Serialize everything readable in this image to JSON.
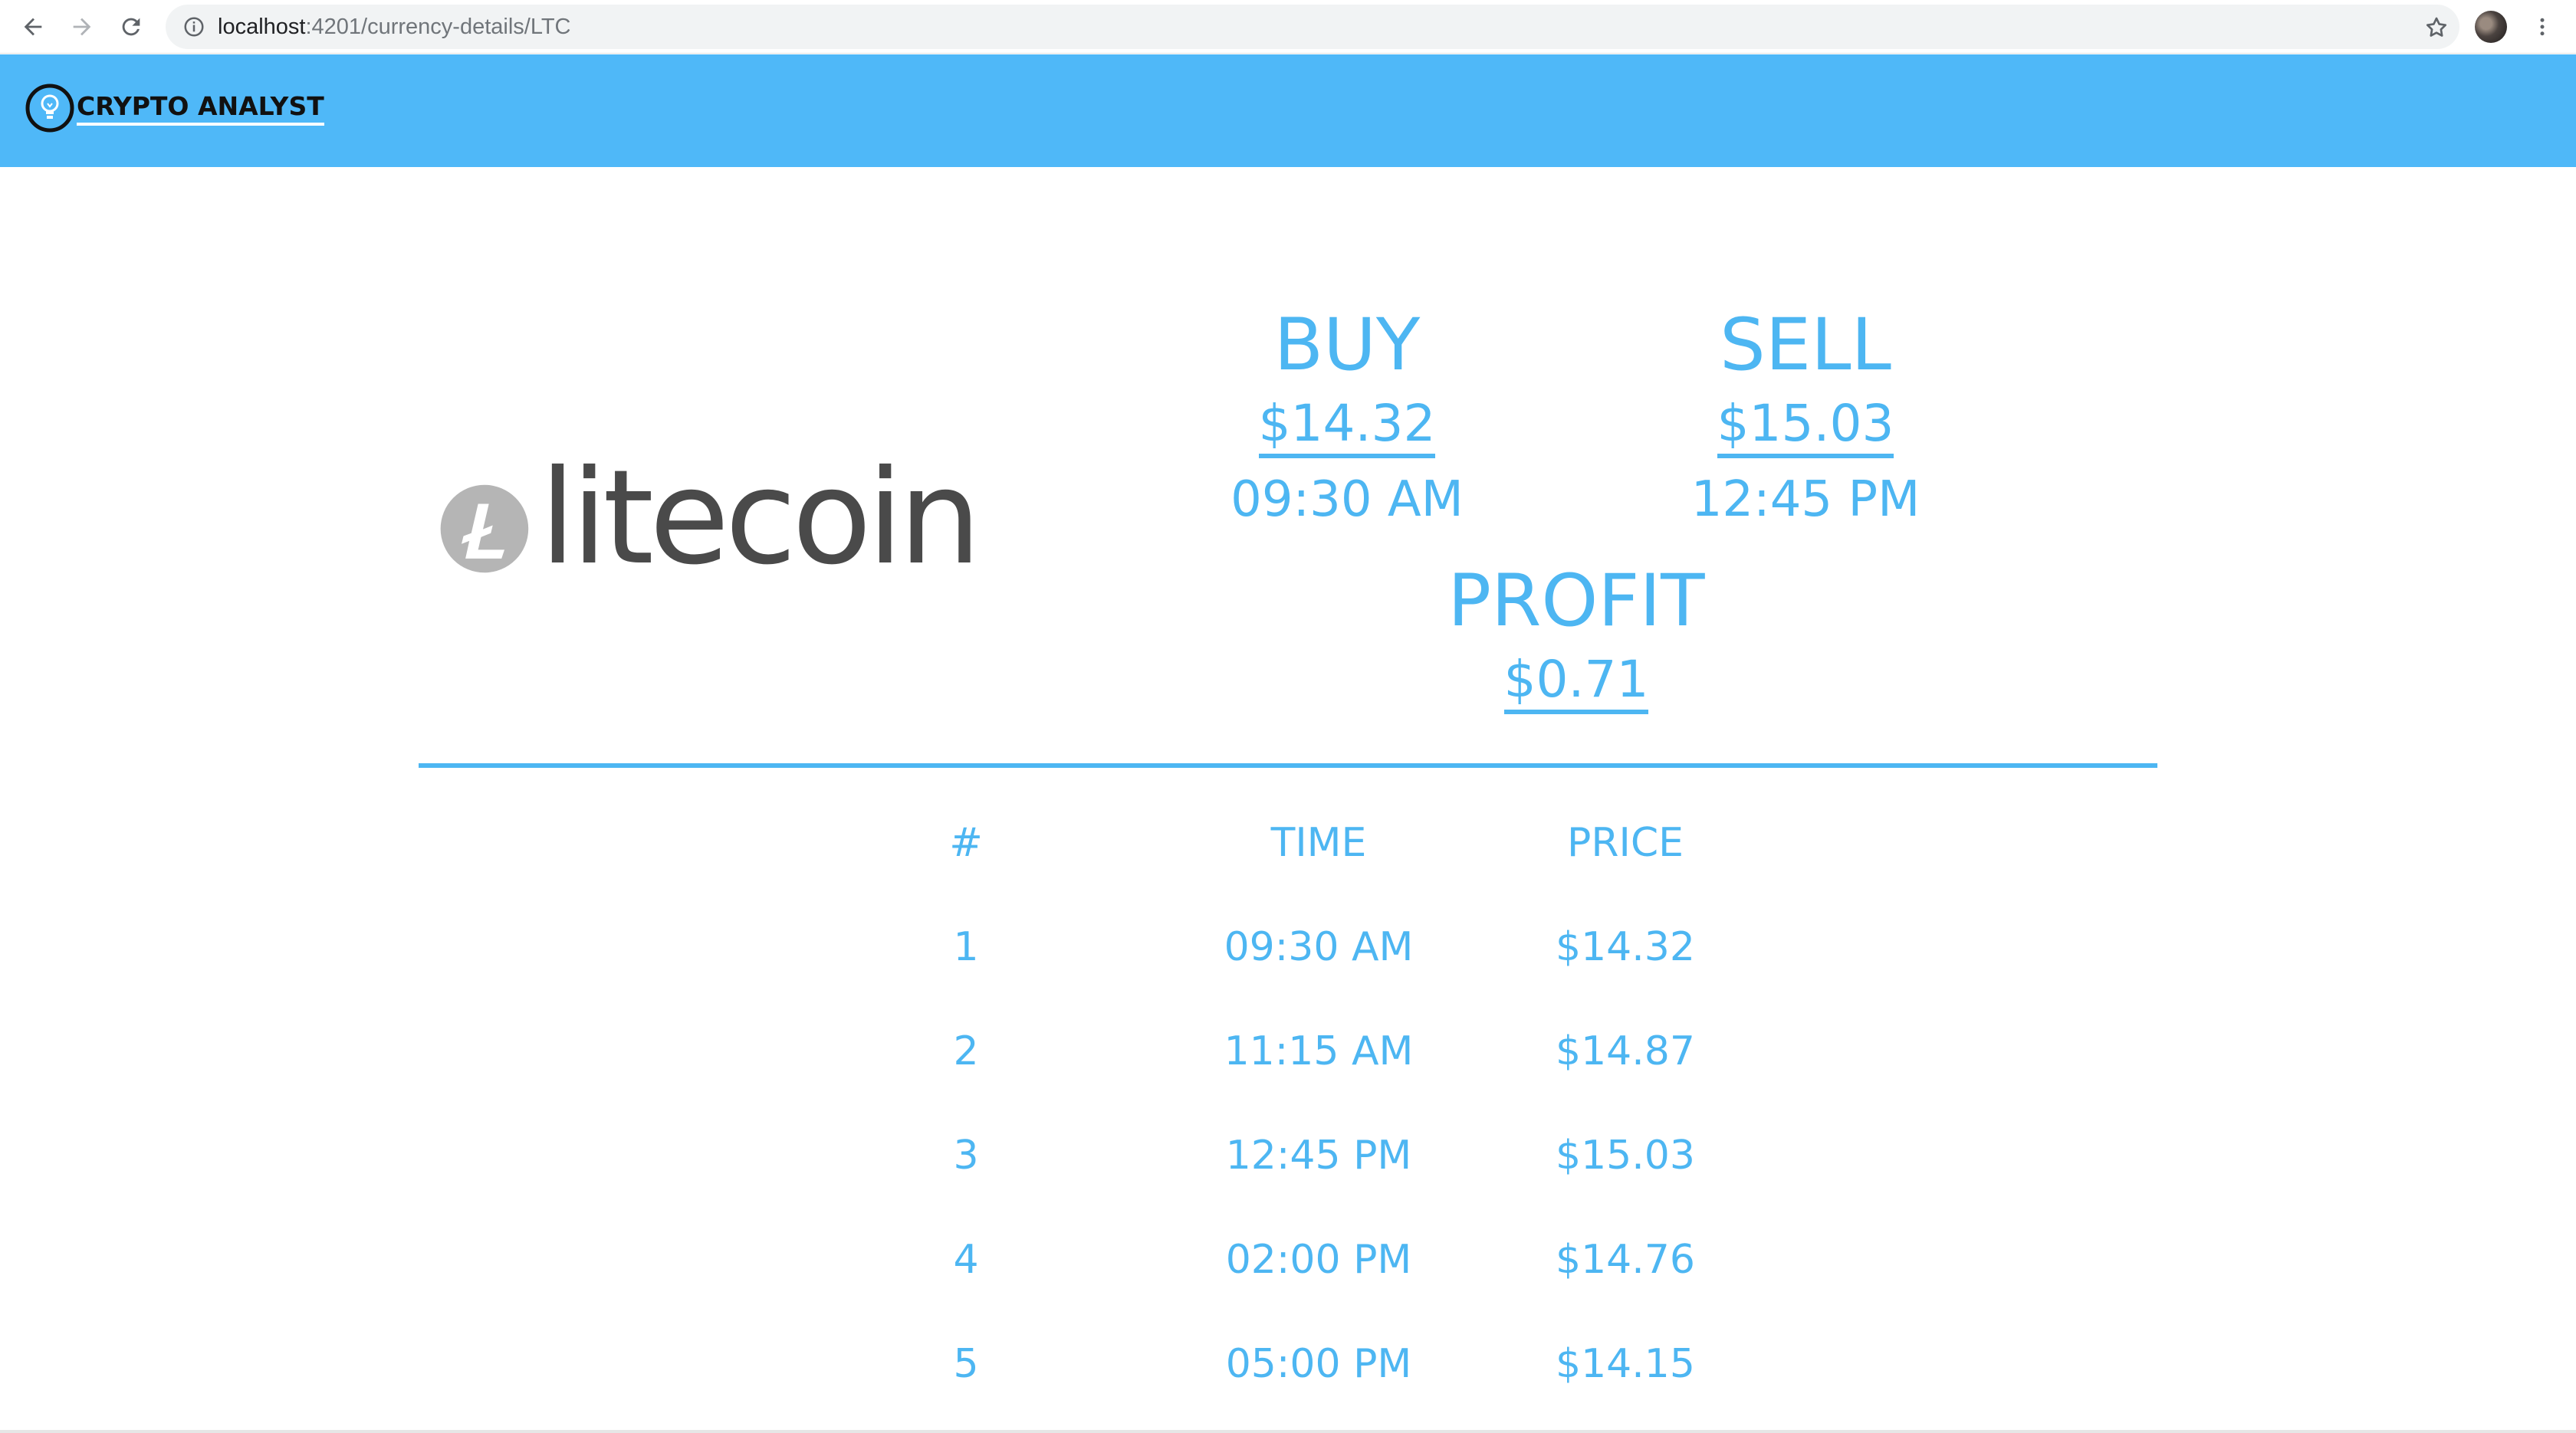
{
  "browser": {
    "url_host": "localhost",
    "url_rest": ":4201/currency-details/LTC"
  },
  "header": {
    "brand": "CRYPTO ANALYST"
  },
  "coin": {
    "name": "litecoin"
  },
  "buy": {
    "title": "BUY",
    "price": "$14.32",
    "time": "09:30 AM"
  },
  "sell": {
    "title": "SELL",
    "price": "$15.03",
    "time": "12:45 PM"
  },
  "profit": {
    "title": "PROFIT",
    "value": "$0.71"
  },
  "table": {
    "columns": [
      "#",
      "TIME",
      "PRICE"
    ],
    "rows": [
      {
        "idx": "1",
        "time": "09:30 AM",
        "price": "$14.32"
      },
      {
        "idx": "2",
        "time": "11:15 AM",
        "price": "$14.87"
      },
      {
        "idx": "3",
        "time": "12:45 PM",
        "price": "$15.03"
      },
      {
        "idx": "4",
        "time": "02:00 PM",
        "price": "$14.76"
      },
      {
        "idx": "5",
        "time": "05:00 PM",
        "price": "$14.15"
      }
    ]
  },
  "colors": {
    "header_bg": "#4fb8f8",
    "accent": "#4db6f2",
    "logo_grey": "#4a4a4a"
  }
}
